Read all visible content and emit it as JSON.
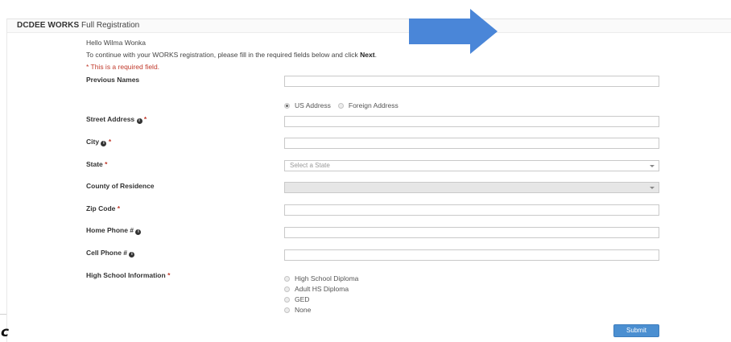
{
  "header": {
    "brand": "DCDEE WORKS",
    "title_rest": " Full Registration"
  },
  "intro": {
    "greeting": "Hello Wilma Wonka",
    "instruction_prefix": "To continue with your WORKS registration, please fill in the required fields below and click ",
    "instruction_bold": "Next",
    "instruction_suffix": ".",
    "required_note": "* This is a required field."
  },
  "fields": {
    "previous_names": {
      "label": "Previous Names"
    },
    "address_type": {
      "options": [
        "US Address",
        "Foreign Address"
      ],
      "selected": "US Address"
    },
    "street_address": {
      "label": "Street Address",
      "star": "*"
    },
    "city": {
      "label": "City",
      "star": "*"
    },
    "state": {
      "label": "State",
      "star": "*",
      "placeholder": "Select a State"
    },
    "county": {
      "label": "County of Residence"
    },
    "zip": {
      "label": "Zip Code",
      "star": "*"
    },
    "home_phone": {
      "label": "Home Phone #"
    },
    "cell_phone": {
      "label": "Cell Phone #"
    },
    "high_school": {
      "label": "High School Information",
      "star": "*",
      "options": [
        "High School Diploma",
        "Adult HS Diploma",
        "GED",
        "None"
      ]
    }
  },
  "info_icon_glyph": "i",
  "submit_label": "Submit",
  "fragment_glyph": "c",
  "colors": {
    "accent_arrow": "#4a86d8",
    "submit": "#4b8fd1",
    "required": "#c0392b"
  },
  "icons": {
    "arrow": "right-arrow-icon",
    "info": "info-icon",
    "caret": "chevron-down-icon"
  }
}
